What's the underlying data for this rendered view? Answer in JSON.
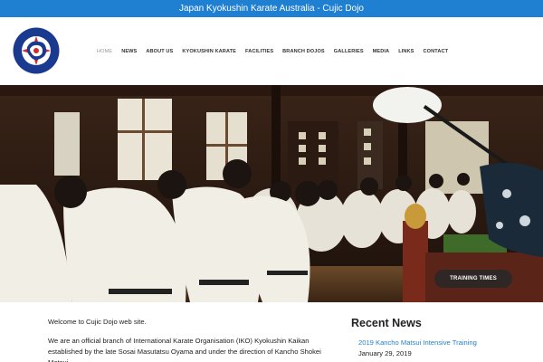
{
  "topbar": {
    "text": "Japan Kyokushin Karate Australia - Cujic Dojo"
  },
  "header": {
    "logo_text_top": "I.K.O. KYOKUSHINKAI KAN AUSTRALIA",
    "logo_text_bottom": "CUJIC BRANCH"
  },
  "nav": {
    "items": [
      {
        "label": "HOME",
        "active": true
      },
      {
        "label": "NEWS"
      },
      {
        "label": "ABOUT US"
      },
      {
        "label": "KYOKUSHIN KARATE"
      },
      {
        "label": "FACILITIES"
      },
      {
        "label": "BRANCH DOJOS"
      },
      {
        "label": "GALLERIES"
      },
      {
        "label": "MEDIA"
      },
      {
        "label": "LINKS"
      },
      {
        "label": "CONTACT"
      }
    ]
  },
  "hero": {
    "button_label": "TRAINING TIMES"
  },
  "content": {
    "welcome": "Welcome to Cujic Dojo web site.",
    "intro": "We are an official branch of International Karate Organisation (IKO) Kyokushin Kaikan established by the late Sosai Masutatsu Oyama and under the direction of Kancho Shokei Matsui."
  },
  "news": {
    "title": "Recent News",
    "items": [
      {
        "title": "2019 Kancho Matsui Intensive Training",
        "date": "January 29, 2019"
      }
    ]
  },
  "colors": {
    "topbar": "#1f7fd1",
    "link": "#1f7fd1",
    "logo_blue": "#1a3a8f",
    "logo_red": "#d42a2a"
  }
}
